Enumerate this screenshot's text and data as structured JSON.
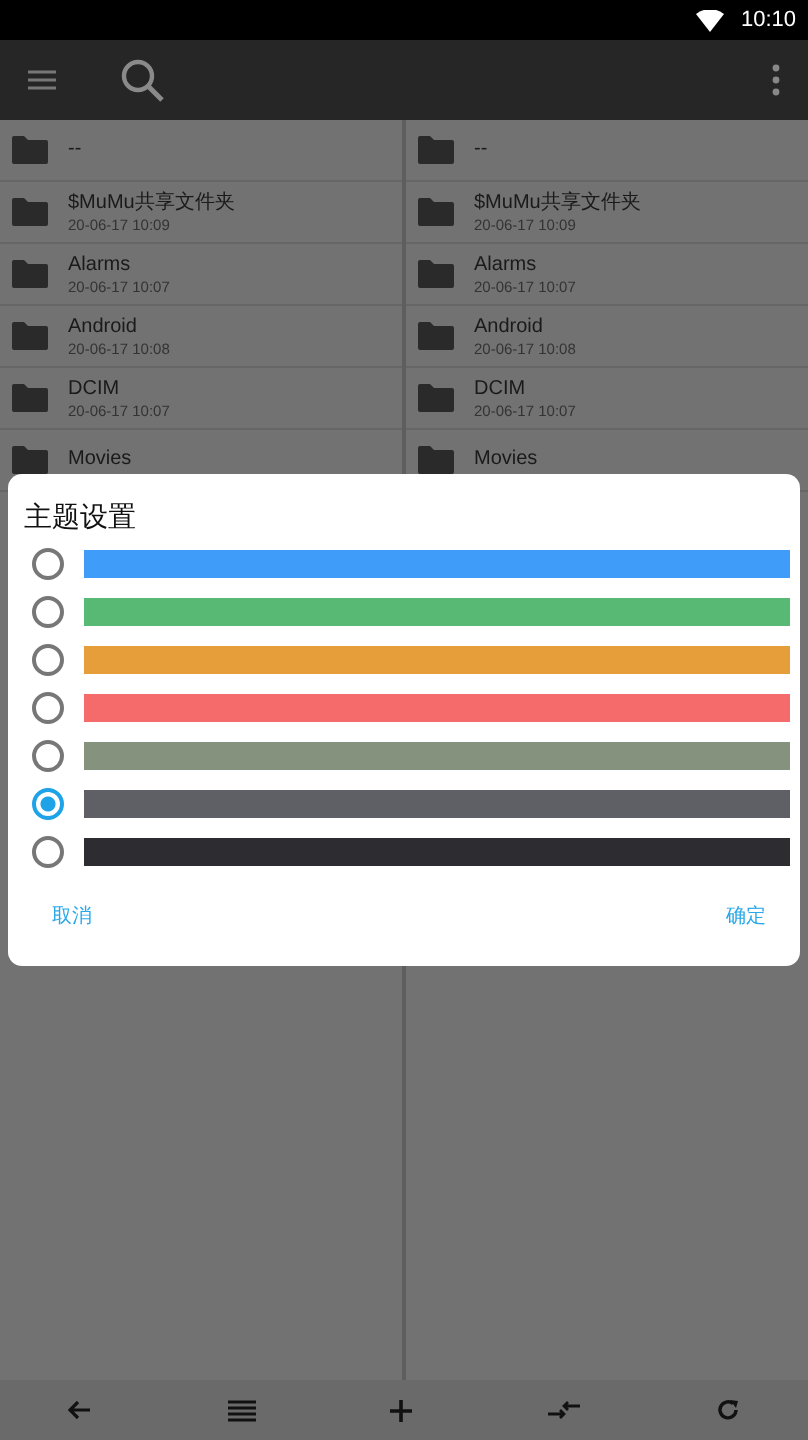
{
  "status_bar": {
    "time": "10:10"
  },
  "panes": [
    {
      "items": [
        {
          "name": "--"
        },
        {
          "name": "$MuMu共享文件夹",
          "date": "20-06-17 10:09"
        },
        {
          "name": "Alarms",
          "date": "20-06-17 10:07"
        },
        {
          "name": "Android",
          "date": "20-06-17 10:08"
        },
        {
          "name": "DCIM",
          "date": "20-06-17 10:07"
        },
        {
          "name": "Movies"
        }
      ]
    },
    {
      "items": [
        {
          "name": "--"
        },
        {
          "name": "$MuMu共享文件夹",
          "date": "20-06-17 10:09"
        },
        {
          "name": "Alarms",
          "date": "20-06-17 10:07"
        },
        {
          "name": "Android",
          "date": "20-06-17 10:08"
        },
        {
          "name": "DCIM",
          "date": "20-06-17 10:07"
        },
        {
          "name": "Movies"
        }
      ]
    }
  ],
  "dialog": {
    "title": "主题设置",
    "options": [
      {
        "color": "#3f9cf8",
        "selected": false
      },
      {
        "color": "#58b974",
        "selected": false
      },
      {
        "color": "#e69e3b",
        "selected": false
      },
      {
        "color": "#f56a6a",
        "selected": false
      },
      {
        "color": "#85937e",
        "selected": false
      },
      {
        "color": "#5f6066",
        "selected": true
      },
      {
        "color": "#2d2d31",
        "selected": false
      }
    ],
    "buttons": [
      "取消",
      "确定"
    ]
  }
}
